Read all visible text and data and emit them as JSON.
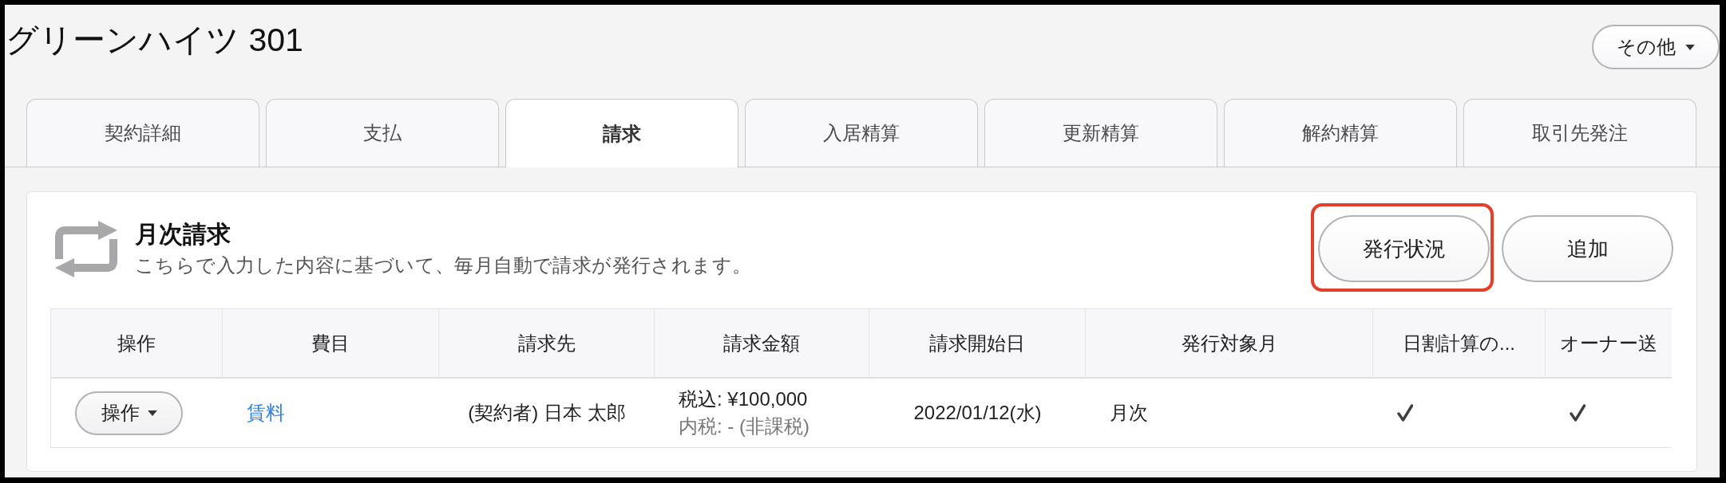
{
  "page": {
    "title": "グリーンハイツ 301",
    "more_button": "その他"
  },
  "tabs": [
    {
      "label": "契約詳細",
      "selected": false
    },
    {
      "label": "支払",
      "selected": false
    },
    {
      "label": "請求",
      "selected": true
    },
    {
      "label": "入居精算",
      "selected": false
    },
    {
      "label": "更新精算",
      "selected": false
    },
    {
      "label": "解約精算",
      "selected": false
    },
    {
      "label": "取引先発注",
      "selected": false
    }
  ],
  "section": {
    "title": "月次請求",
    "description": "こちらで入力した内容に基づいて、毎月自動で請求が発行されます。",
    "buttons": [
      {
        "label": "発行状況",
        "highlighted": true
      },
      {
        "label": "追加",
        "highlighted": false
      }
    ]
  },
  "table": {
    "columns": [
      "操作",
      "費目",
      "請求先",
      "請求金額",
      "請求開始日",
      "発行対象月",
      "日割計算の...",
      "オーナー送"
    ],
    "rows": [
      {
        "cells": [
          {
            "kind": "button",
            "text": "操作"
          },
          {
            "kind": "link",
            "text": "賃料"
          },
          {
            "kind": "text",
            "text": "(契約者) 日本 太郎"
          },
          {
            "kind": "amount",
            "text": "税込: ¥100,000",
            "note": "内税: - (非課税)"
          },
          {
            "kind": "text",
            "text": "2022/01/12(水)"
          },
          {
            "kind": "text",
            "text": "月次"
          },
          {
            "kind": "check",
            "checked": true
          },
          {
            "kind": "check",
            "checked": true
          }
        ]
      }
    ]
  }
}
